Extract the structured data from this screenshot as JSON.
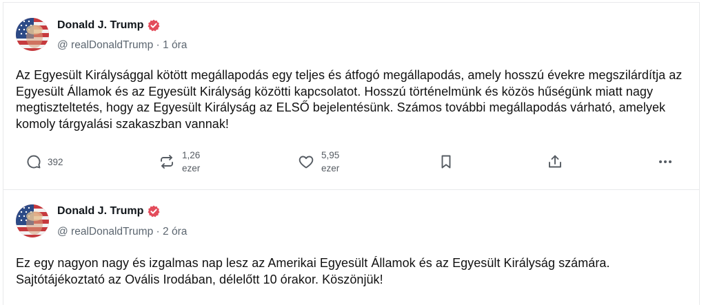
{
  "posts": [
    {
      "author": "Donald J. Trump",
      "handle": "@ realDonaldTrump",
      "separator": "·",
      "time": "1 óra",
      "text": "Az Egyesült Királysággal kötött megállapodás egy teljes és átfogó megállapodás, amely hosszú évekre megszilárdítja az Egyesült Államok és az Egyesült Királyság közötti kapcsolatot. Hosszú történelmünk és közös hűségünk miatt nagy megtiszteltetés, hogy az Egyesült Királyság az ELSŐ bejelentésünk. Számos további megállapodás várható, amelyek komoly tárgyalási szakaszban vannak!",
      "replies": "392",
      "reposts_value": "1,26",
      "reposts_unit": "ezer",
      "likes_value": "5,95",
      "likes_unit": "ezer"
    },
    {
      "author": "Donald J. Trump",
      "handle": "@ realDonaldTrump",
      "separator": "·",
      "time": "2 óra",
      "text": "Ez egy nagyon nagy és izgalmas nap lesz az Amerikai Egyesült Államok és az Egyesült Királyság számára. Sajtótájékoztató az Ovális Irodában, délelőtt 10 órakor. Köszönjük!"
    }
  ],
  "icons": {
    "verified_color": "#e34c5b",
    "reply": "reply-icon",
    "repost": "repost-icon",
    "like": "heart-icon",
    "bookmark": "bookmark-icon",
    "share": "share-icon",
    "more": "more-icon"
  }
}
